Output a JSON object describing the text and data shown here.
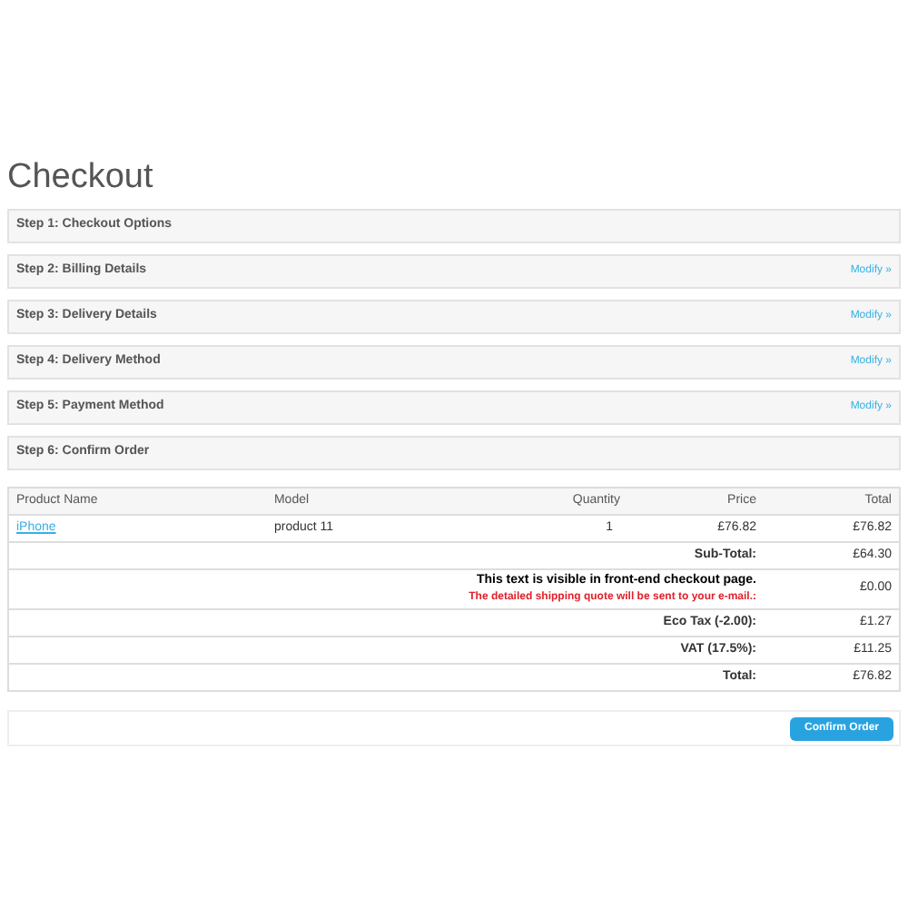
{
  "title": "Checkout",
  "steps": [
    {
      "label": "Step 1: Checkout Options"
    },
    {
      "label": "Step 2: Billing Details",
      "link": "Modify »"
    },
    {
      "label": "Step 3: Delivery Details",
      "link": "Modify »"
    },
    {
      "label": "Step 4: Delivery Method",
      "link": "Modify »"
    },
    {
      "label": "Step 5: Payment Method",
      "link": "Modify »"
    },
    {
      "label": "Step 6: Confirm Order"
    }
  ],
  "table": {
    "columns": [
      "Product Name",
      "Model",
      "Quantity",
      "Price",
      "Total"
    ],
    "rows": [
      {
        "name": "iPhone",
        "model": "product 11",
        "quantity": "1",
        "price": "£76.82",
        "total": "£76.82"
      }
    ],
    "totals": [
      {
        "kind": "plain",
        "label": "Sub-Total:",
        "value": "£64.30"
      },
      {
        "kind": "note",
        "note": "This text is visible in front-end checkout page.",
        "warning": "The detailed shipping quote will be sent to your e-mail.:",
        "value": "£0.00"
      },
      {
        "kind": "plain",
        "label": "Eco Tax (-2.00):",
        "value": "£1.27"
      },
      {
        "kind": "plain",
        "label": "VAT (17.5%):",
        "value": "£11.25"
      },
      {
        "kind": "plain",
        "label": "Total:",
        "value": "£76.82"
      }
    ]
  },
  "confirm_button": "Confirm Order"
}
